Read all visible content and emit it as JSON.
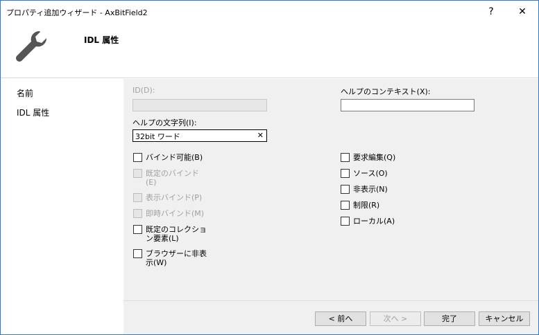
{
  "window": {
    "title": "プロパティ追加ウィザード - AxBitField2",
    "help": "?",
    "close": "✕"
  },
  "header": {
    "title": "IDL 属性"
  },
  "sidebar": {
    "items": [
      {
        "label": "名前"
      },
      {
        "label": "IDL 属性"
      }
    ]
  },
  "form": {
    "id_label": "ID(D):",
    "id_value": "",
    "help_string_label": "ヘルプの文字列(I):",
    "help_string_value": "32bit ワード",
    "clear": "✕",
    "help_context_label": "ヘルプのコンテキスト(X):",
    "help_context_value": "",
    "left_checkboxes": [
      {
        "label": "バインド可能(B)",
        "checked": false,
        "enabled": true
      },
      {
        "label": "既定のバインド(E)",
        "checked": false,
        "enabled": false
      },
      {
        "label": "表示バインド(P)",
        "checked": false,
        "enabled": false
      },
      {
        "label": "即時バインド(M)",
        "checked": false,
        "enabled": false
      },
      {
        "label": "既定のコレクション要素(L)",
        "checked": false,
        "enabled": true
      },
      {
        "label": "ブラウザーに非表示(W)",
        "checked": false,
        "enabled": true
      }
    ],
    "right_checkboxes": [
      {
        "label": "要求編集(Q)",
        "checked": false
      },
      {
        "label": "ソース(O)",
        "checked": false
      },
      {
        "label": "非表示(N)",
        "checked": false
      },
      {
        "label": "制限(R)",
        "checked": false
      },
      {
        "label": "ローカル(A)",
        "checked": false
      }
    ]
  },
  "buttons": {
    "back": "< 前へ",
    "next": "次へ >",
    "finish": "完了",
    "cancel": "キャンセル"
  }
}
